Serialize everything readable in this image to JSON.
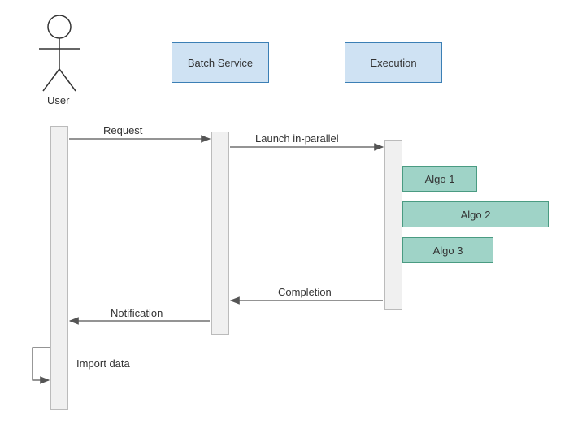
{
  "actors": {
    "user": "User",
    "batch_service": "Batch Service",
    "execution": "Execution"
  },
  "messages": {
    "request": "Request",
    "launch": "Launch in-parallel",
    "completion": "Completion",
    "notification": "Notification",
    "import_data": "Import data"
  },
  "algos": {
    "a1": "Algo 1",
    "a2": "Algo 2",
    "a3": "Algo 3"
  },
  "colors": {
    "header_fill": "#cfe2f3",
    "header_stroke": "#3b7fb5",
    "lifeline_fill": "#f0f0f0",
    "lifeline_stroke": "#bbbbbb",
    "algo_fill": "#9fd3c7",
    "algo_stroke": "#4a9b82",
    "arrow": "#555555"
  }
}
